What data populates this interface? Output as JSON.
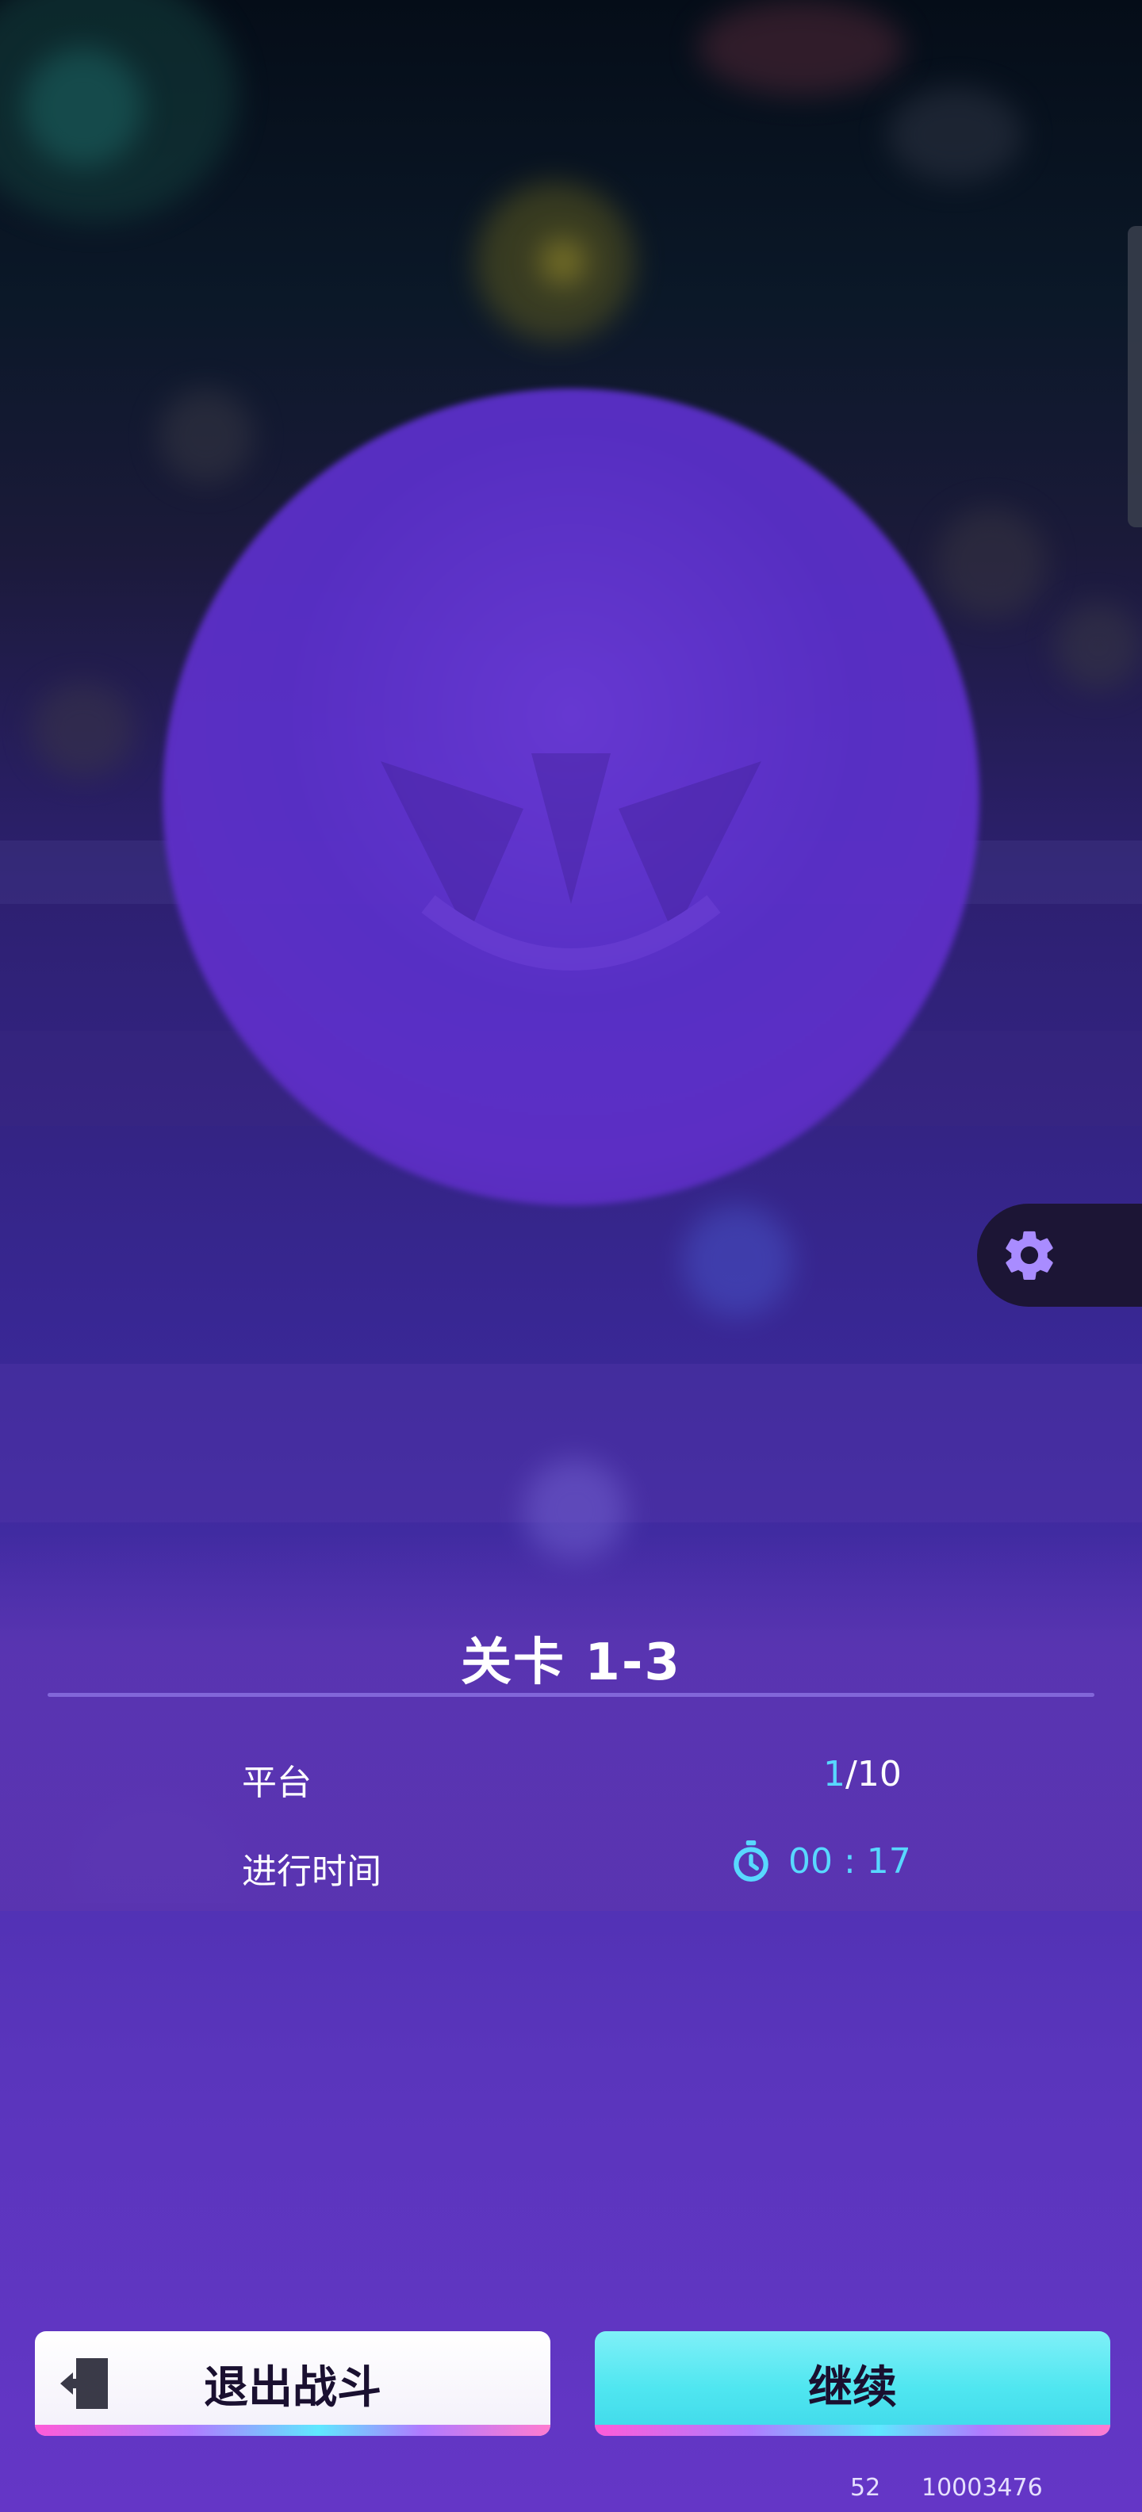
{
  "level": {
    "title": "关卡 1-3"
  },
  "stats": [
    {
      "label": "平台",
      "value_current": "1",
      "value_total": "/10"
    },
    {
      "label": "进行时间",
      "value": "00 : 17",
      "icon": "stopwatch-icon"
    }
  ],
  "buttons": {
    "exit_label": "退出战斗",
    "continue_label": "继续"
  },
  "footer": {
    "left": "52",
    "right": "10003476"
  },
  "colors": {
    "accent": "#58d8ff",
    "continue_button": "#4fe6f0",
    "panel": "#5a34b0",
    "settings_pill": "#1c1535",
    "gear": "#a98cff"
  }
}
